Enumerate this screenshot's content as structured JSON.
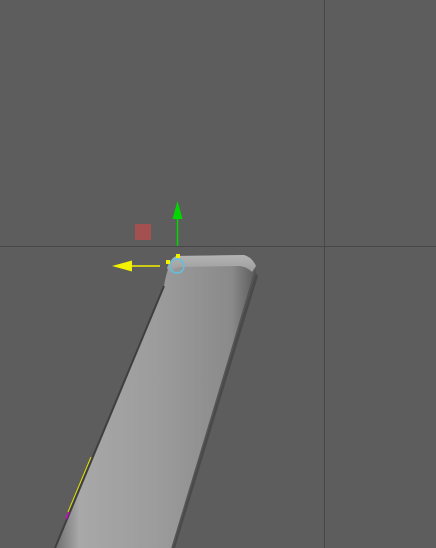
{
  "viewport": {
    "background_color": "#5d5d5d",
    "grid_line_color": "#474747"
  },
  "mesh": {
    "shape": "rounded-box-extrusion",
    "fill_color": "#999999",
    "highlight_color": "#b0b0b0",
    "shadow_color": "#444444"
  },
  "manipulator": {
    "type": "move",
    "y_axis_color": "#00d800",
    "x_axis_color": "#f2f200",
    "plane_handle_color": "#b04e4e",
    "pivot_color": "#5fc0e0",
    "selected_vertex_color": "#f2f200"
  },
  "selection_edge_colors": [
    "#e0e000",
    "#d000d0"
  ]
}
